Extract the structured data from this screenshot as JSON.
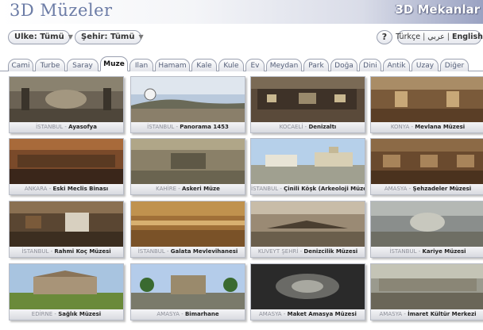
{
  "header": {
    "site_title": "3D Müzeler",
    "site_subtitle": "3D Mekanlar"
  },
  "filters": {
    "country": {
      "label": "Ulke: Tümü",
      "icon": "chevron-down-icon"
    },
    "city": {
      "label": "Şehir: Tümü",
      "icon": "chevron-down-icon"
    },
    "help_label": "?",
    "languages": [
      "Türkçe",
      "عربي",
      "English"
    ],
    "active_language": "English"
  },
  "tabs": [
    {
      "label": "Cami"
    },
    {
      "label": "Turbe"
    },
    {
      "label": "Saray"
    },
    {
      "label": "Muze"
    },
    {
      "label": "Ilan"
    },
    {
      "label": "Hamam"
    },
    {
      "label": "Kale"
    },
    {
      "label": "Kule"
    },
    {
      "label": "Ev"
    },
    {
      "label": "Meydan"
    },
    {
      "label": "Park"
    },
    {
      "label": "Doğa"
    },
    {
      "label": "Dini"
    },
    {
      "label": "Antik"
    },
    {
      "label": "Uzay"
    },
    {
      "label": "Diğer"
    }
  ],
  "active_tab": "Muze",
  "tiles": [
    {
      "city": "İSTANBUL",
      "name": "Ayasofya"
    },
    {
      "city": "İSTANBUL",
      "name": "Panorama 1453"
    },
    {
      "city": "KOCAELİ",
      "name": "Denizaltı"
    },
    {
      "city": "KONYA",
      "name": "Mevlana Müzesi"
    },
    {
      "city": "ANKARA",
      "name": "Eski Meclis Binası"
    },
    {
      "city": "KAHİRE",
      "name": "Askeri Müze"
    },
    {
      "city": "İSTANBUL",
      "name": "Çinili Köşk (Arkeoloji Müzesi)"
    },
    {
      "city": "AMASYA",
      "name": "Şehzadeler Müzesi"
    },
    {
      "city": "İSTANBUL",
      "name": "Rahmi Koç Müzesi"
    },
    {
      "city": "İSTANBUL",
      "name": "Galata Mevlevihanesi"
    },
    {
      "city": "KUVEYT ŞEHRİ",
      "name": "Denizcilik Müzesi"
    },
    {
      "city": "İSTANBUL",
      "name": "Kariye Müzesi"
    },
    {
      "city": "EDİRNE",
      "name": "Sağlık Müzesi"
    },
    {
      "city": "AMASYA",
      "name": "Bimarhane"
    },
    {
      "city": "AMASYA",
      "name": "Maket Amasya Müzesi"
    },
    {
      "city": "AMASYA",
      "name": "İmaret Kültür Merkezi"
    }
  ],
  "tile_caption_separator": "-"
}
